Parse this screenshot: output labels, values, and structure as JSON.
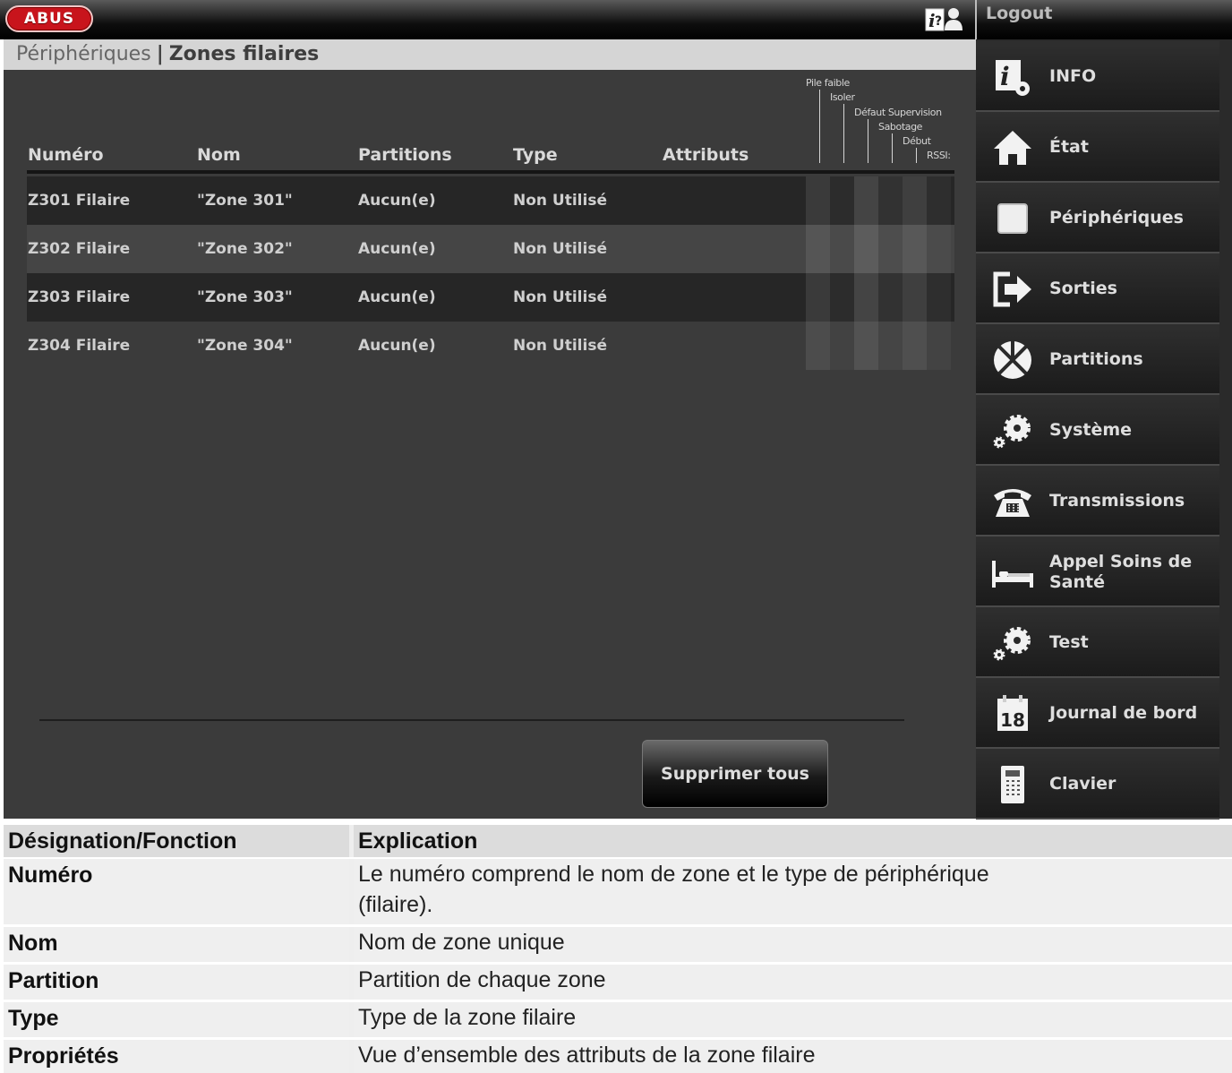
{
  "app": {
    "logo_text": "ABUS",
    "logout_label": "Logout"
  },
  "breadcrumb": {
    "parent": "Périphériques",
    "separator": "|",
    "current": "Zones filaires"
  },
  "table": {
    "columns": [
      "Numéro",
      "Nom",
      "Partitions",
      "Type",
      "Attributs"
    ],
    "attribute_labels": [
      "Pile faible",
      "Isoler",
      "Défaut Supervision",
      "Sabotage",
      "Début",
      "RSSI:"
    ],
    "rows": [
      {
        "numero": "Z301 Filaire",
        "nom": "\"Zone 301\"",
        "partitions": "Aucun(e)",
        "type": "Non Utilisé"
      },
      {
        "numero": "Z302 Filaire",
        "nom": "\"Zone 302\"",
        "partitions": "Aucun(e)",
        "type": "Non Utilisé"
      },
      {
        "numero": "Z303 Filaire",
        "nom": "\"Zone 303\"",
        "partitions": "Aucun(e)",
        "type": "Non Utilisé"
      },
      {
        "numero": "Z304 Filaire",
        "nom": "\"Zone 304\"",
        "partitions": "Aucun(e)",
        "type": "Non Utilisé"
      }
    ]
  },
  "actions": {
    "delete_all": "Supprimer tous"
  },
  "sidebar": {
    "items": [
      {
        "label": "INFO",
        "icon": "info-gear-icon"
      },
      {
        "label": "État",
        "icon": "home-icon"
      },
      {
        "label": "Périphériques",
        "icon": "device-square-icon"
      },
      {
        "label": "Sorties",
        "icon": "exit-arrow-icon"
      },
      {
        "label": "Partitions",
        "icon": "partitions-pie-icon"
      },
      {
        "label": "Système",
        "icon": "gears-icon"
      },
      {
        "label": "Transmissions",
        "icon": "telephone-icon"
      },
      {
        "label": "Appel Soins de Santé",
        "icon": "bed-icon"
      },
      {
        "label": "Test",
        "icon": "gears-icon"
      },
      {
        "label": "Journal de bord",
        "icon": "calendar-icon"
      },
      {
        "label": "Clavier",
        "icon": "keypad-icon"
      }
    ],
    "calendar_day": "18"
  },
  "explanation": {
    "header": {
      "designation": "Désignation/Fonction",
      "explanation": "Explication"
    },
    "rows": [
      {
        "designation": "Numéro",
        "explanation_lines": [
          "Le numéro comprend le nom de zone et le type de périphérique",
          "(filaire)."
        ]
      },
      {
        "designation": "Nom",
        "explanation_lines": [
          "Nom de zone unique"
        ]
      },
      {
        "designation": "Partition",
        "explanation_lines": [
          "Partition de chaque zone"
        ]
      },
      {
        "designation": "Type",
        "explanation_lines": [
          "Type de la zone filaire"
        ]
      },
      {
        "designation": "Propriétés",
        "explanation_lines": [
          "Vue d’ensemble des attributs de la zone filaire"
        ]
      }
    ]
  },
  "colors": {
    "panel_bg": "#3b3b3b",
    "row_dark": "#262626",
    "row_light": "#454545",
    "logo_red": "#c8141c"
  }
}
